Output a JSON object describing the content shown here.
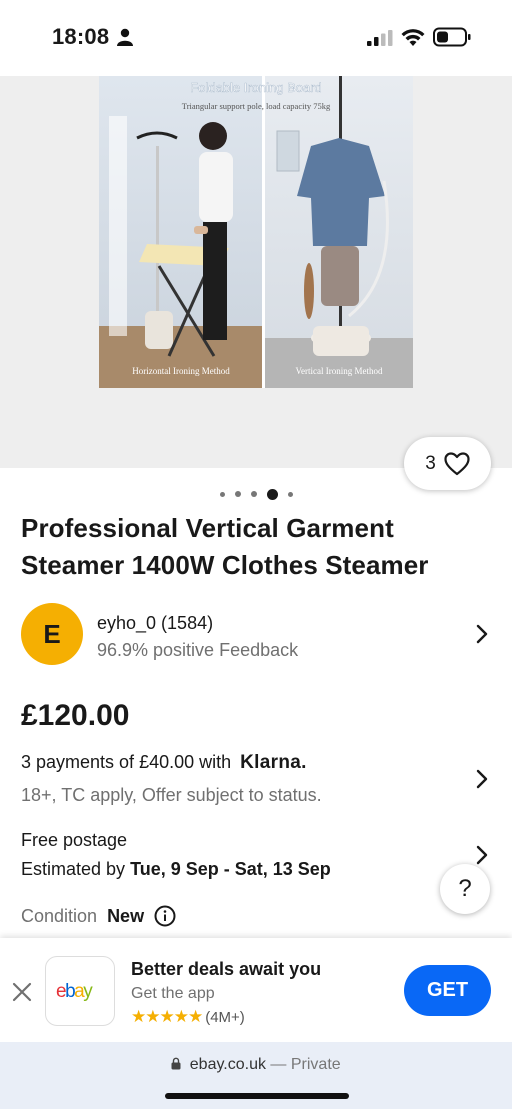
{
  "status_bar": {
    "time": "18:08"
  },
  "gallery": {
    "image_heading": "Foldable Ironing Board",
    "image_subheading": "Triangular support pole, load capacity 75kg",
    "image_caption_left": "Horizontal Ironing Method",
    "image_caption_right": "Vertical Ironing Method",
    "favourite_count": "3",
    "page_count": 5,
    "active_page": 4
  },
  "listing": {
    "title": "Professional Vertical Garment Steamer 1400W Clothes Steamer",
    "seller": {
      "avatar_letter": "E",
      "name": "eyho_0 (1584)",
      "feedback": "96.9% positive Feedback"
    },
    "price": "£120.00",
    "klarna": {
      "text": "3 payments of £40.00 with",
      "brand": "Klarna.",
      "note": "18+, TC apply, Offer subject to status."
    },
    "postage": {
      "label": "Free postage",
      "estimated_prefix": "Estimated by",
      "estimated_dates": "Tue, 9 Sep - Sat, 13 Sep"
    },
    "condition": {
      "label": "Condition",
      "value": "New"
    },
    "help_label": "?"
  },
  "app_banner": {
    "app_logo": "ebay",
    "title": "Better deals await you",
    "subtitle": "Get the app",
    "stars": "★★★★★",
    "rating_count": "(4M+)",
    "get_label": "GET"
  },
  "url_bar": {
    "domain": "ebay.co.uk",
    "mode": "— Private"
  },
  "colors": {
    "accent": "#0968f6",
    "avatar": "#f5af02",
    "text": "#191919",
    "muted": "#707070"
  }
}
